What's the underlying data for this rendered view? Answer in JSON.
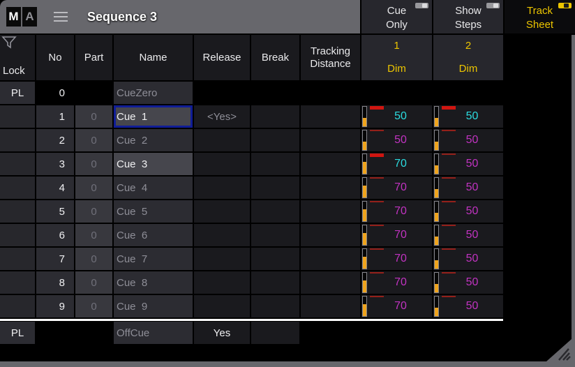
{
  "window": {
    "title": "Sequence 3",
    "logo": [
      "M",
      "A"
    ]
  },
  "toolbar": {
    "buttons": [
      {
        "label": "Cue\nOnly",
        "state": "off"
      },
      {
        "label": "Show\nSteps",
        "state": "off"
      },
      {
        "label": "Track\nSheet",
        "state": "on"
      }
    ]
  },
  "colors": {
    "accent_yellow": "#ecc500",
    "cyan": "#2bdce0",
    "magenta": "#c133c1",
    "fader_fill": "#efa41d",
    "changed_bar": "#d01510",
    "tracked_bar": "#94201a",
    "focus_border": "#101d97",
    "titlebar_grey": "#67676c"
  },
  "table": {
    "headers": {
      "lock": "Lock",
      "no": "No",
      "part": "Part",
      "name": "Name",
      "release": "Release",
      "break": "Break",
      "tracking": "Tracking Distance"
    },
    "track_columns": [
      {
        "number": "1",
        "attribute": "Dim"
      },
      {
        "number": "2",
        "attribute": "Dim"
      }
    ],
    "rows": [
      {
        "style": "cuezero",
        "lock": "PL",
        "no": "0",
        "part": "",
        "name": "CueZero",
        "release": "",
        "values": [
          null,
          null
        ]
      },
      {
        "style": "cue",
        "lock": "",
        "no": "1",
        "part": "0",
        "name": "Cue  1",
        "name_state": "focused",
        "release": "<Yes>",
        "values": [
          {
            "value": "50",
            "color": "cyan",
            "bar": "thick",
            "level": 44
          },
          {
            "value": "50",
            "color": "cyan",
            "bar": "thick",
            "level": 44
          }
        ]
      },
      {
        "style": "cue",
        "lock": "",
        "no": "2",
        "part": "0",
        "name": "Cue  2",
        "name_state": "normal",
        "release": "",
        "values": [
          {
            "value": "50",
            "color": "magenta",
            "bar": "thin",
            "level": 44
          },
          {
            "value": "50",
            "color": "magenta",
            "bar": "thin",
            "level": 44
          }
        ]
      },
      {
        "style": "cue",
        "lock": "",
        "no": "3",
        "part": "0",
        "name": "Cue  3",
        "name_state": "active",
        "release": "",
        "values": [
          {
            "value": "70",
            "color": "cyan",
            "bar": "thick",
            "level": 62
          },
          {
            "value": "50",
            "color": "magenta",
            "bar": "thin",
            "level": 44
          }
        ]
      },
      {
        "style": "cue",
        "lock": "",
        "no": "4",
        "part": "0",
        "name": "Cue  4",
        "name_state": "normal",
        "release": "",
        "values": [
          {
            "value": "70",
            "color": "magenta",
            "bar": "thin",
            "level": 62
          },
          {
            "value": "50",
            "color": "magenta",
            "bar": "thin",
            "level": 44
          }
        ]
      },
      {
        "style": "cue",
        "lock": "",
        "no": "5",
        "part": "0",
        "name": "Cue  5",
        "name_state": "normal",
        "release": "",
        "values": [
          {
            "value": "70",
            "color": "magenta",
            "bar": "thin",
            "level": 62
          },
          {
            "value": "50",
            "color": "magenta",
            "bar": "thin",
            "level": 44
          }
        ]
      },
      {
        "style": "cue",
        "lock": "",
        "no": "6",
        "part": "0",
        "name": "Cue  6",
        "name_state": "normal",
        "release": "",
        "values": [
          {
            "value": "70",
            "color": "magenta",
            "bar": "thin",
            "level": 62
          },
          {
            "value": "50",
            "color": "magenta",
            "bar": "thin",
            "level": 44
          }
        ]
      },
      {
        "style": "cue",
        "lock": "",
        "no": "7",
        "part": "0",
        "name": "Cue  7",
        "name_state": "normal",
        "release": "",
        "values": [
          {
            "value": "70",
            "color": "magenta",
            "bar": "thin",
            "level": 62
          },
          {
            "value": "50",
            "color": "magenta",
            "bar": "thin",
            "level": 44
          }
        ]
      },
      {
        "style": "cue",
        "lock": "",
        "no": "8",
        "part": "0",
        "name": "Cue  8",
        "name_state": "normal",
        "release": "",
        "values": [
          {
            "value": "70",
            "color": "magenta",
            "bar": "thin",
            "level": 62
          },
          {
            "value": "50",
            "color": "magenta",
            "bar": "thin",
            "level": 44
          }
        ]
      },
      {
        "style": "cue",
        "lock": "",
        "no": "9",
        "part": "0",
        "name": "Cue  9",
        "name_state": "normal",
        "release": "",
        "values": [
          {
            "value": "70",
            "color": "magenta",
            "bar": "thin",
            "level": 62
          },
          {
            "value": "50",
            "color": "magenta",
            "bar": "thin",
            "level": 44
          }
        ]
      },
      {
        "style": "offcue",
        "lock": "PL",
        "no": "",
        "part": "",
        "name": "OffCue",
        "release": "Yes",
        "values": [
          null,
          null
        ]
      }
    ]
  }
}
